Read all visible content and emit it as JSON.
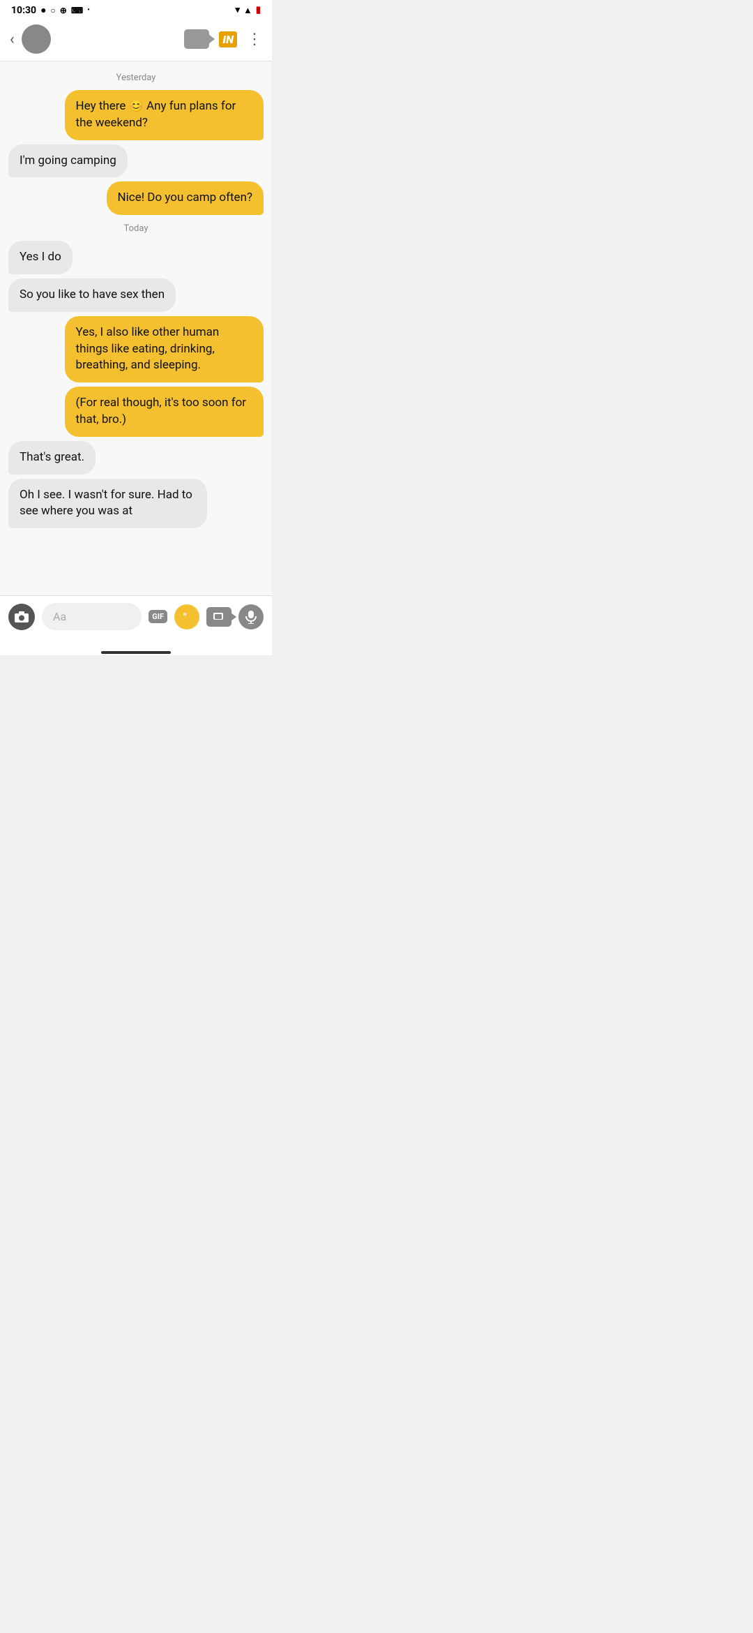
{
  "status": {
    "time": "10:30",
    "wifi": "▲",
    "signal": "▲",
    "battery": "🔋"
  },
  "header": {
    "back_label": "‹",
    "video_label": "video",
    "in_label": "IN",
    "more_label": "⋮"
  },
  "date_labels": {
    "yesterday": "Yesterday",
    "today": "Today"
  },
  "messages": [
    {
      "id": "msg1",
      "type": "sent",
      "text": "Hey there 😊 Any fun plans for the weekend?"
    },
    {
      "id": "msg2",
      "type": "received",
      "text": "I'm going camping"
    },
    {
      "id": "msg3",
      "type": "sent",
      "text": "Nice! Do you camp often?"
    },
    {
      "id": "msg4",
      "type": "received",
      "text": "Yes I do"
    },
    {
      "id": "msg5",
      "type": "received",
      "text": "So you like to have sex then"
    },
    {
      "id": "msg6",
      "type": "sent",
      "text": "Yes, I also like other human things like eating, drinking, breathing, and sleeping."
    },
    {
      "id": "msg7",
      "type": "sent",
      "text": "(For real though, it's too soon for that, bro.)"
    },
    {
      "id": "msg8",
      "type": "received",
      "text": "That's great."
    },
    {
      "id": "msg9",
      "type": "received",
      "text": "Oh I see. I wasn't for sure. Had to see where you was at"
    }
  ],
  "bottom_bar": {
    "placeholder": "Aa",
    "gif_label": "GIF"
  }
}
